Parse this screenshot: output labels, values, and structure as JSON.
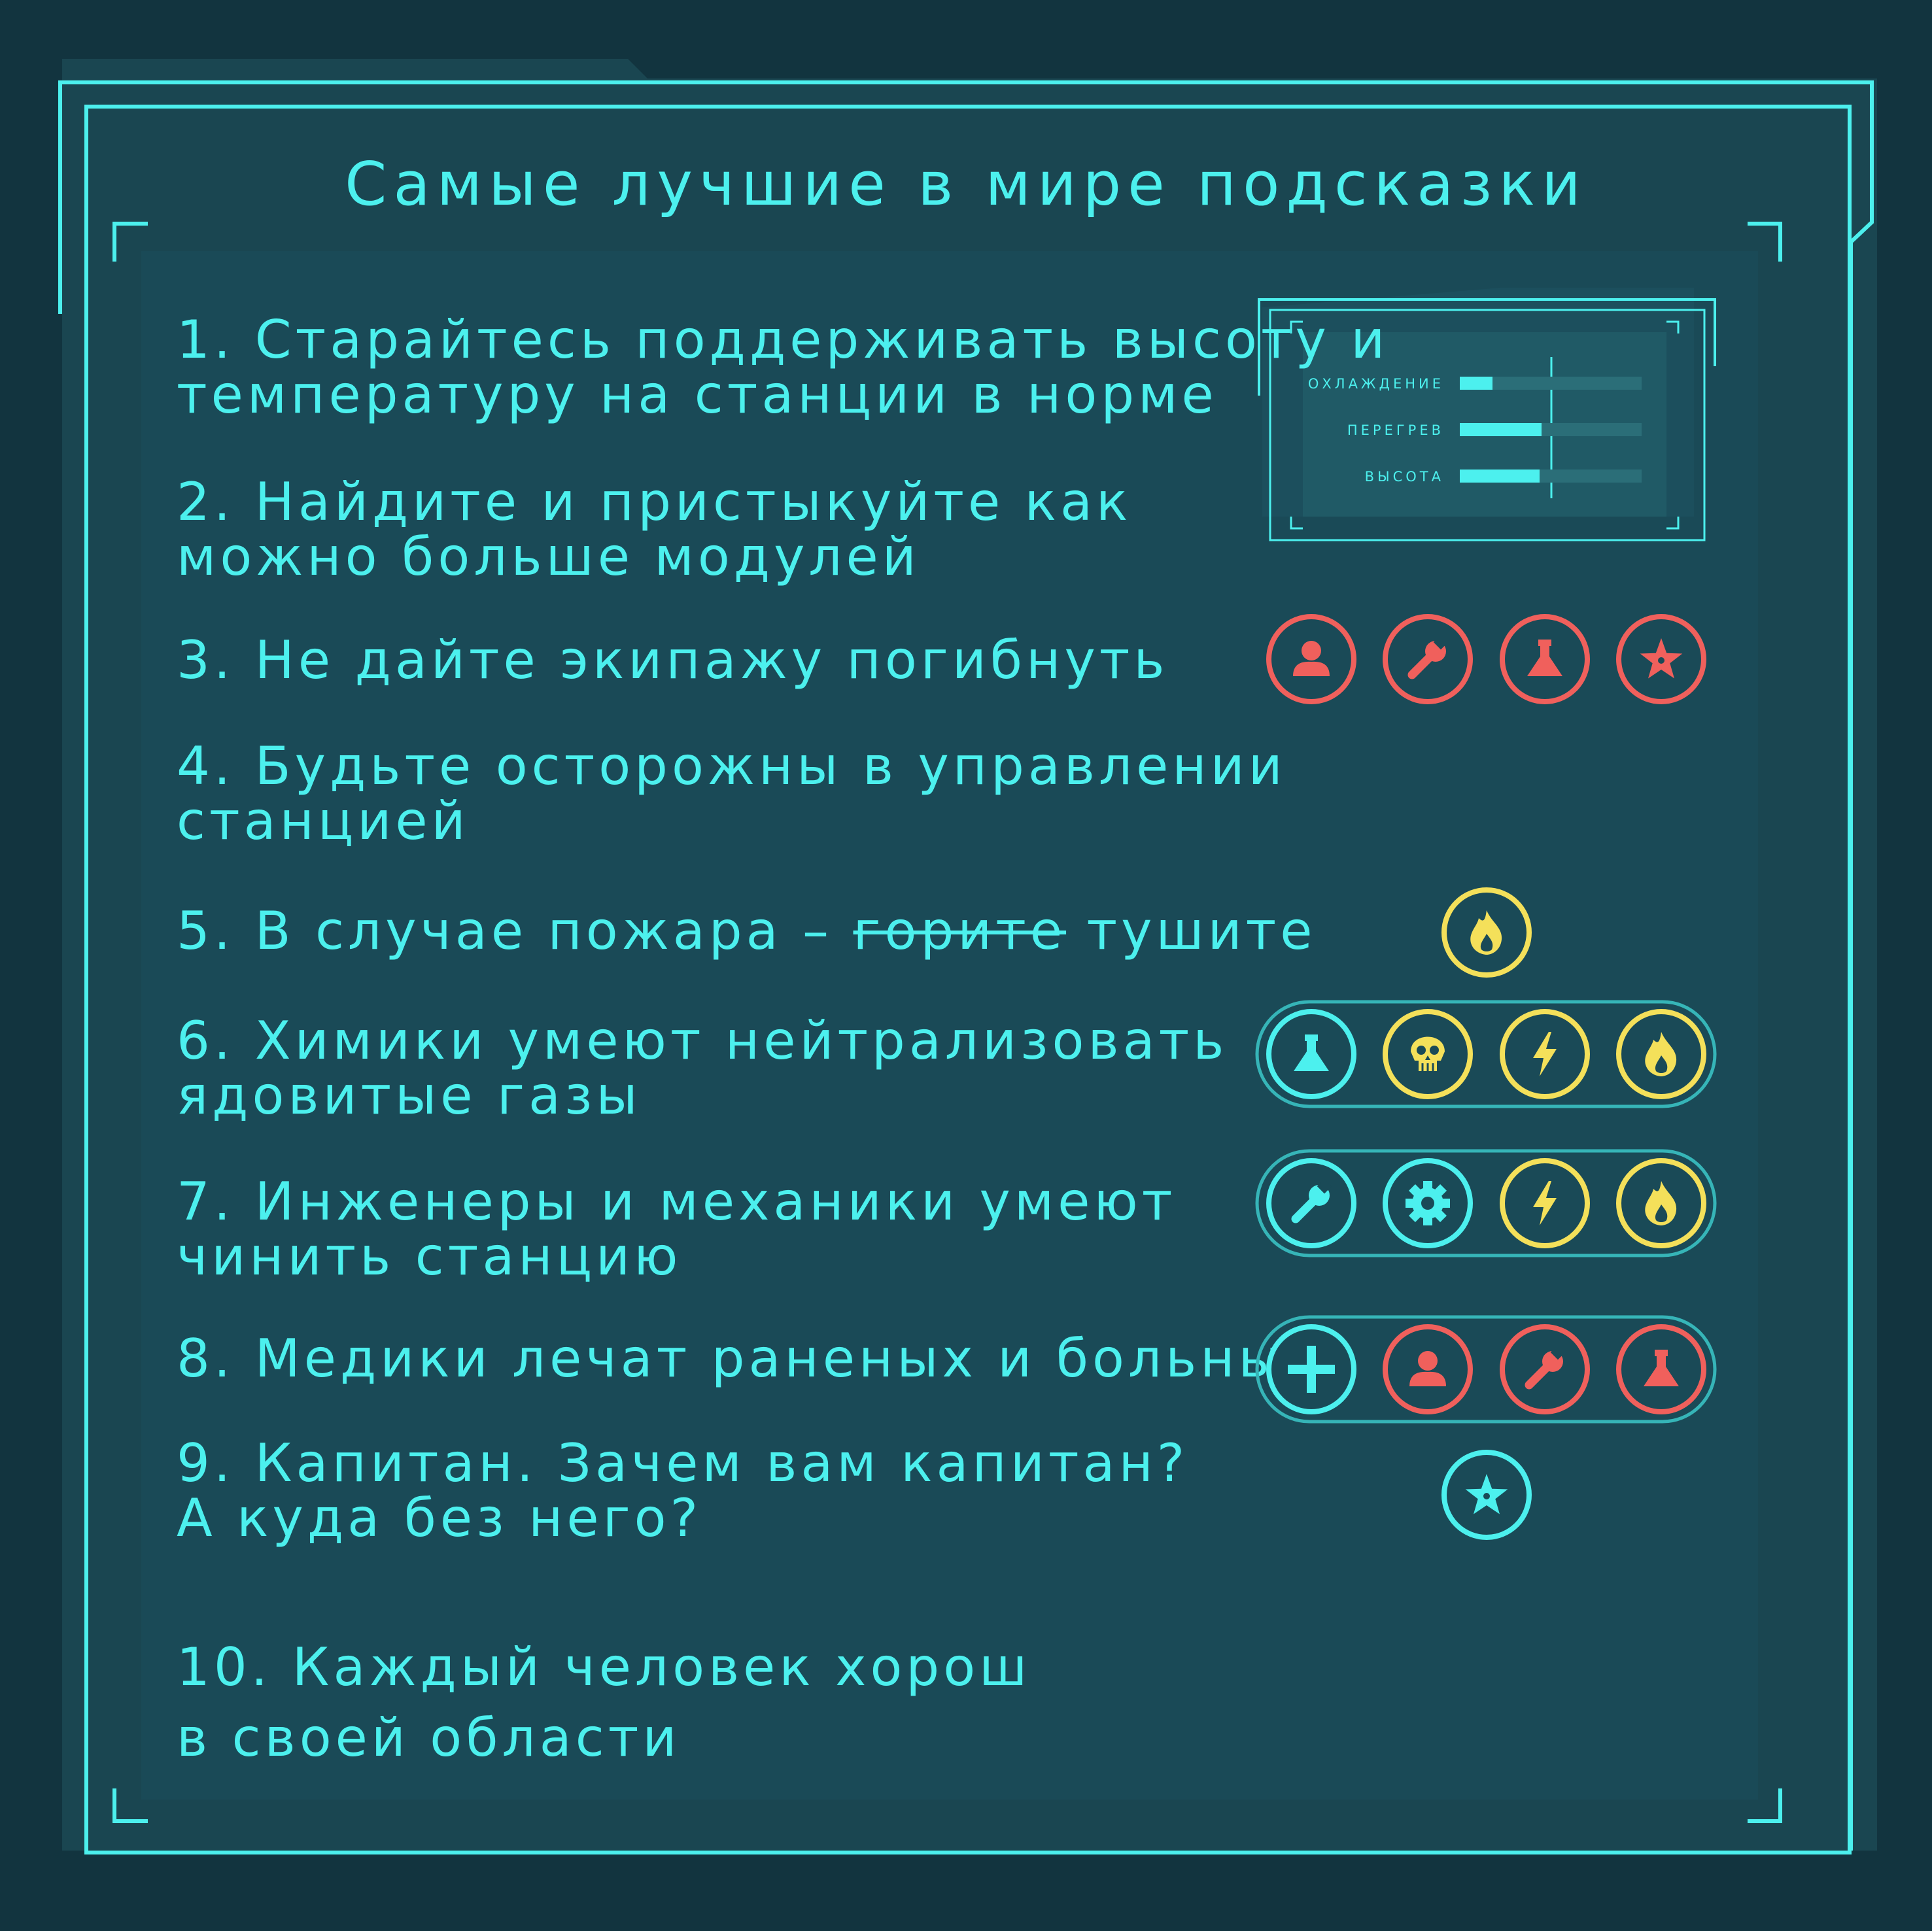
{
  "title": "Самые лучшие в мире подсказки",
  "colors": {
    "background": "#12343f",
    "panel": "#1a4a57",
    "accent": "#4cf0ee",
    "red": "#f0605c",
    "yellow": "#f4e05a"
  },
  "tips": [
    {
      "number": "1.",
      "lines": [
        "Старайтесь поддерживать высоту и",
        "температуру на станции в норме"
      ]
    },
    {
      "number": "2.",
      "lines": [
        "Найдите и пристыкуйте как",
        "можно больше модулей"
      ]
    },
    {
      "number": "3.",
      "lines": [
        "Не дайте экипажу погибнуть"
      ]
    },
    {
      "number": "4.",
      "lines": [
        "Будьте осторожны в управлении",
        "станцией"
      ]
    },
    {
      "number": "5.",
      "lead": "В случае пожара – ",
      "struck": "горите",
      "tail": " тушите"
    },
    {
      "number": "6.",
      "lines": [
        "Химики умеют нейтрализовать",
        "ядовитые газы"
      ]
    },
    {
      "number": "7.",
      "lines": [
        "Инженеры и механики умеют",
        "чинить станцию"
      ]
    },
    {
      "number": "8.",
      "lines": [
        "Медики лечат раненых и больных"
      ]
    },
    {
      "number": "9.",
      "lines": [
        "Капитан. Зачем вам капитан?",
        "А куда без него?"
      ]
    },
    {
      "number": "10.",
      "lines": [
        "Каждый человек хорош",
        "в своей области"
      ]
    }
  ],
  "stats_panel": {
    "bars": [
      {
        "label": "ОХЛАЖДЕНИЕ",
        "level": 0.18
      },
      {
        "label": "ПЕРЕГРЕВ",
        "level": 0.45
      },
      {
        "label": "ВЫСОТА",
        "level": 0.44
      }
    ]
  },
  "icon_rows": {
    "crew": [
      {
        "icon": "person-icon",
        "color": "red"
      },
      {
        "icon": "wrench-icon",
        "color": "red"
      },
      {
        "icon": "flask-icon",
        "color": "red"
      },
      {
        "icon": "star-icon",
        "color": "red"
      }
    ],
    "fire": [
      {
        "icon": "fire-icon",
        "color": "yellow"
      }
    ],
    "chemist": [
      {
        "icon": "flask-icon",
        "color": "cyan"
      },
      {
        "icon": "skull-icon",
        "color": "yellow"
      },
      {
        "icon": "lightning-icon",
        "color": "yellow"
      },
      {
        "icon": "fire-icon",
        "color": "yellow"
      }
    ],
    "engineer": [
      {
        "icon": "wrench-icon",
        "color": "cyan"
      },
      {
        "icon": "gear-icon",
        "color": "cyan"
      },
      {
        "icon": "lightning-icon",
        "color": "yellow"
      },
      {
        "icon": "fire-icon",
        "color": "yellow"
      }
    ],
    "medic": [
      {
        "icon": "plus-icon",
        "color": "cyan"
      },
      {
        "icon": "person-icon",
        "color": "red"
      },
      {
        "icon": "wrench-icon",
        "color": "red"
      },
      {
        "icon": "flask-icon",
        "color": "red"
      }
    ],
    "captain": [
      {
        "icon": "star-icon",
        "color": "cyan"
      }
    ]
  }
}
